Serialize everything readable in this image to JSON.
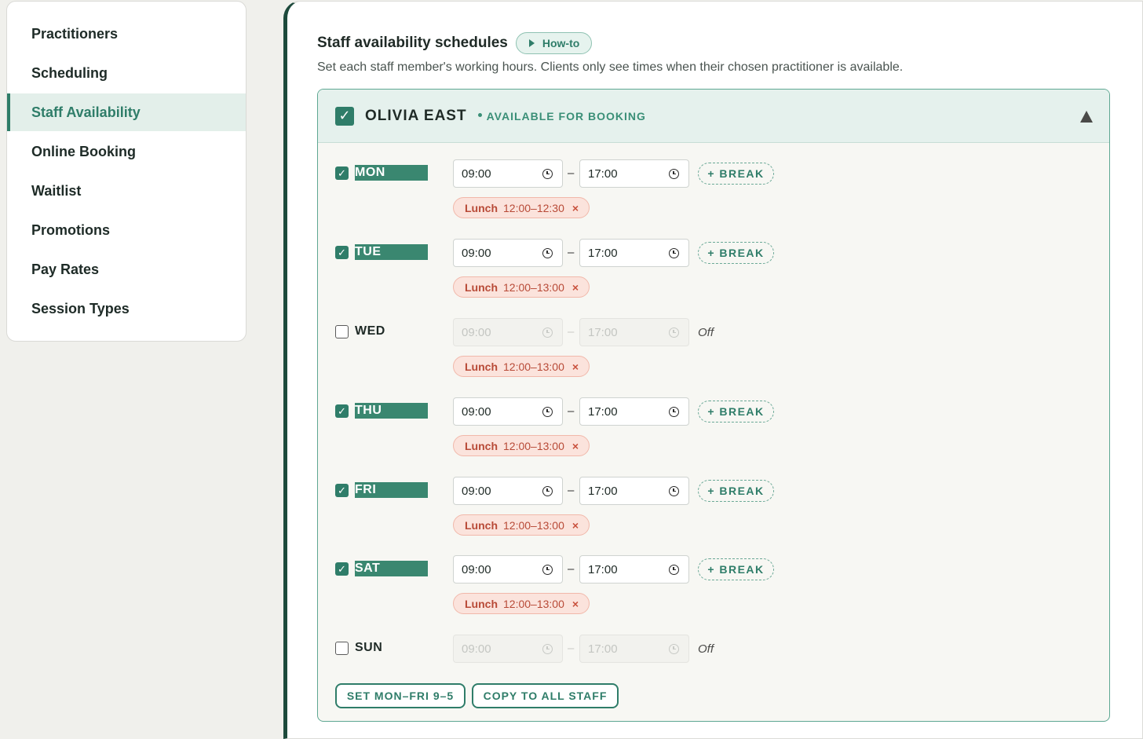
{
  "sidebar": {
    "items": [
      {
        "label": "Practitioners",
        "active": false
      },
      {
        "label": "Scheduling",
        "active": false
      },
      {
        "label": "Staff Availability",
        "active": true
      },
      {
        "label": "Online Booking",
        "active": false
      },
      {
        "label": "Waitlist",
        "active": false
      },
      {
        "label": "Promotions",
        "active": false
      },
      {
        "label": "Pay Rates",
        "active": false
      },
      {
        "label": "Session Types",
        "active": false
      }
    ]
  },
  "main": {
    "title": "Staff availability schedules",
    "howto_label": "How-to",
    "subtitle": "Set each staff member's working hours. Clients only see times when their chosen practitioner is available."
  },
  "staff": {
    "name": "OLIVIA EAST",
    "status": "AVAILABLE FOR BOOKING",
    "checked": true,
    "days": [
      {
        "label": "MON",
        "enabled": true,
        "start": "09:00",
        "end": "17:00",
        "break_label": "+ BREAK",
        "break_name": "Lunch",
        "break_time": "12:00–12:30"
      },
      {
        "label": "TUE",
        "enabled": true,
        "start": "09:00",
        "end": "17:00",
        "break_label": "+ BREAK",
        "break_name": "Lunch",
        "break_time": "12:00–13:00"
      },
      {
        "label": "WED",
        "enabled": false,
        "start": "09:00",
        "end": "17:00",
        "off_label": "Off",
        "break_name": "Lunch",
        "break_time": "12:00–13:00"
      },
      {
        "label": "THU",
        "enabled": true,
        "start": "09:00",
        "end": "17:00",
        "break_label": "+ BREAK",
        "break_name": "Lunch",
        "break_time": "12:00–13:00"
      },
      {
        "label": "FRI",
        "enabled": true,
        "start": "09:00",
        "end": "17:00",
        "break_label": "+ BREAK",
        "break_name": "Lunch",
        "break_time": "12:00–13:00"
      },
      {
        "label": "SAT",
        "enabled": true,
        "start": "09:00",
        "end": "17:00",
        "break_label": "+ BREAK",
        "break_name": "Lunch",
        "break_time": "12:00–13:00"
      },
      {
        "label": "SUN",
        "enabled": false,
        "start": "09:00",
        "end": "17:00",
        "off_label": "Off"
      }
    ],
    "set_weekdays_label": "SET MON–FRI 9–5",
    "copy_all_label": "COPY TO ALL STAFF"
  },
  "colors": {
    "accent": "#2f7d69",
    "accent_dark": "#1d4a3c",
    "break_bg": "#fbe3dc",
    "break_text": "#b84a37"
  }
}
